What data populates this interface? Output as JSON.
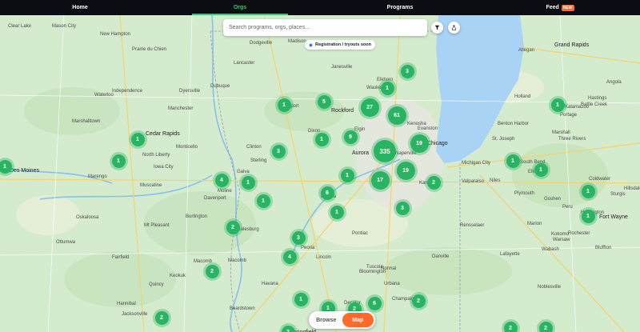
{
  "nav": {
    "home": "Home",
    "orgs": "Orgs",
    "programs": "Programs",
    "feed": "Feed",
    "feed_badge": "NEW"
  },
  "search": {
    "placeholder": "Search programs, orgs, places..."
  },
  "legend": {
    "label": "Registration / tryouts soon"
  },
  "view_toggle": {
    "browse": "Browse",
    "map": "Map",
    "selected": "Map"
  },
  "colors": {
    "nav_bg": "#0b0d12",
    "accent": "#2ecc6a",
    "badge": "#ff6a2b",
    "cluster": "#28b463",
    "lake": "#a9d3f5"
  },
  "clusters": [
    "335",
    "61",
    "27",
    "19",
    "19",
    "17",
    "9",
    "6",
    "6",
    "5",
    "4",
    "4",
    "3",
    "3",
    "3",
    "3",
    "2",
    "2",
    "2",
    "2",
    "2",
    "2",
    "2",
    "2",
    "2",
    "1",
    "1",
    "1",
    "1",
    "1",
    "1",
    "1",
    "1",
    "1",
    "1",
    "1",
    "1",
    "1",
    "1",
    "1",
    "1",
    "1"
  ],
  "place_labels": [
    "Clear Lake",
    "Mason City",
    "New Hampton",
    "Prairie du Chien",
    "Madison",
    "Janesville",
    "Milwaukee",
    "Waukesha",
    "Lancaster",
    "Dodgeville",
    "Elkhorn",
    "Kenosha",
    "Rockford",
    "Freeport",
    "Dubuque",
    "Dyersville",
    "Cedar Rapids",
    "North Liberty",
    "Iowa City",
    "Des Moines",
    "Marengo",
    "Muscatine",
    "Clinton",
    "Galva",
    "Elgin",
    "Aurora",
    "Evanston",
    "Chicago",
    "Naperville",
    "Joliet",
    "Kankakee",
    "Ottawa",
    "Peoria",
    "Bloomington",
    "Normal",
    "Champaign",
    "Springfield",
    "Decatur",
    "Macomb",
    "Galesburg",
    "Burlington",
    "Quincy",
    "Keokuk",
    "Danville",
    "Valparaiso",
    "Michigan City",
    "South Bend",
    "Elkhart",
    "Grand Rapids",
    "Holland",
    "Kalamazoo",
    "Portage",
    "Benton Harbor",
    "Battle Creek",
    "Fort Wayne",
    "Warsaw",
    "Lafayette",
    "Hannibal",
    "Plymouth",
    "Three Rivers",
    "Rochester",
    "Bluffton",
    "Rensselaer",
    "Pontiac",
    "Sterling",
    "Dixon",
    "Moline",
    "Davenport",
    "Waterloo",
    "Independence",
    "Manchester",
    "Monticello",
    "Marshalltown",
    "Oskaloosa",
    "Ottumwa",
    "Fairfield",
    "Mt Pleasant",
    "Macomb",
    "Havana",
    "Beardstown",
    "Jacksonville",
    "Lincoln",
    "Clinton",
    "Urbana",
    "Tuscola",
    "Noblesville",
    "Kokomo",
    "Marion",
    "Peru",
    "Wabash",
    "Huntington",
    "Angola",
    "Goshen",
    "Niles",
    "St. Joseph",
    "Allegan",
    "Hastings",
    "Marshall",
    "Coldwater",
    "Sturgis",
    "Hillsdale"
  ]
}
